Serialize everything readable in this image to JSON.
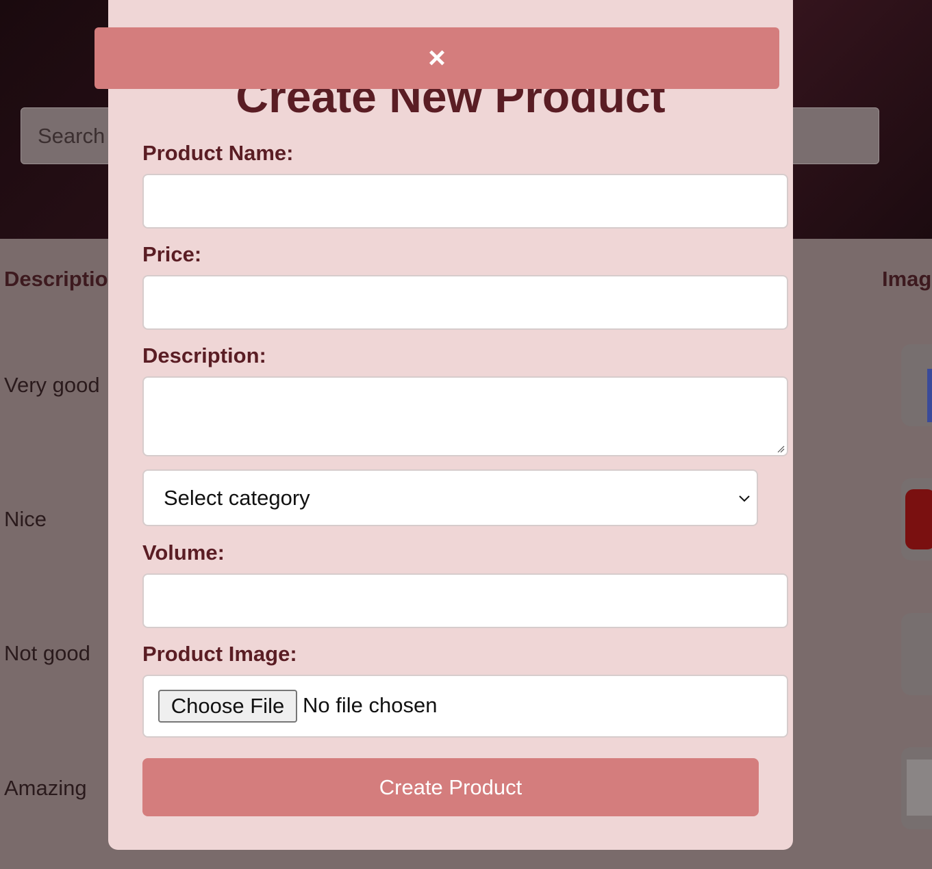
{
  "background": {
    "search": {
      "placeholder": "Search"
    },
    "table": {
      "headers": {
        "description": "Descriptio",
        "image": "Imag"
      },
      "rows": [
        {
          "description": "Very good"
        },
        {
          "description": "Nice"
        },
        {
          "description": "Not good"
        },
        {
          "description": "Amazing"
        }
      ]
    }
  },
  "modal": {
    "title": "Create New Product",
    "close_icon": "×",
    "fields": {
      "product_name": {
        "label": "Product Name:",
        "value": ""
      },
      "price": {
        "label": "Price:",
        "value": ""
      },
      "description": {
        "label": "Description:",
        "value": ""
      },
      "category": {
        "selected": "Select category"
      },
      "volume": {
        "label": "Volume:",
        "value": ""
      },
      "product_image": {
        "label": "Product Image:",
        "button": "Choose File",
        "status": "No file chosen"
      }
    },
    "submit_label": "Create Product"
  },
  "colors": {
    "accent": "#d47d7d",
    "modal_bg": "#efd6d6",
    "label_text": "#5a1d24",
    "overlay_bg": "#7a6b6b"
  }
}
